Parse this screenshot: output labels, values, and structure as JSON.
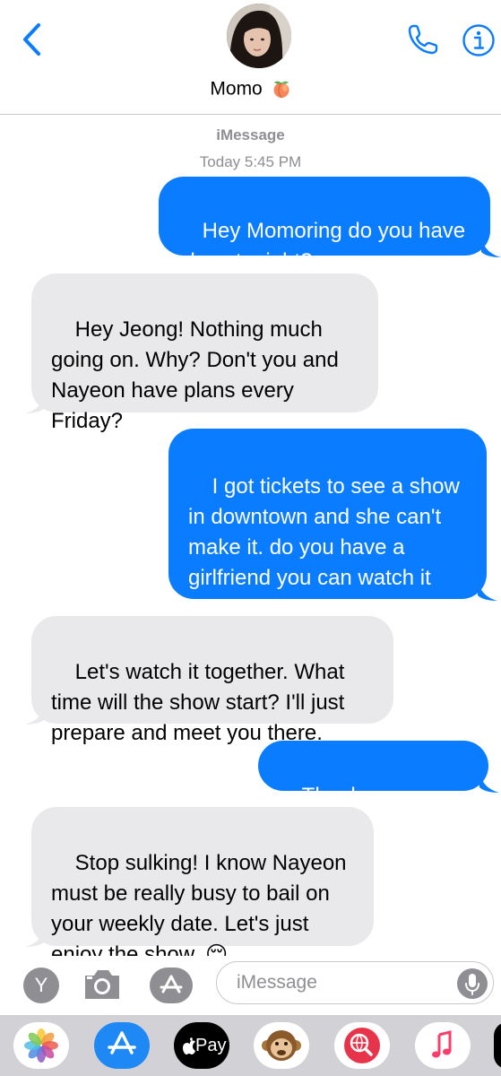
{
  "header": {
    "contact_name": "Momo",
    "contact_emoji": "peach",
    "back_icon": "chevron-left-icon",
    "call_icon": "phone-icon",
    "info_icon": "info-icon",
    "accent_color": "#0a7cff"
  },
  "thread": {
    "service": "iMessage",
    "timestamp": "Today 5:45 PM",
    "messages": [
      {
        "from": "me",
        "text": "Hey Momoring do you have plans tonight?"
      },
      {
        "from": "them",
        "text": "Hey Jeong! Nothing much going on. Why? Don't you and Nayeon have plans every Friday?"
      },
      {
        "from": "me",
        "text": "I got tickets to see a show in downtown and she can't make it. do you have a girlfriend you can watch it with? I'll give it to you."
      },
      {
        "from": "them",
        "text": "Let's watch it together. What time will the show start? I'll just prepare and meet you there."
      },
      {
        "from": "me",
        "text": "Thank you Momo."
      },
      {
        "from": "them",
        "text": "Stop sulking! I know Nayeon must be really busy to bail on your weekly date. Let's just enjoy the show. 😌"
      }
    ],
    "sent_color": "#0a7cff",
    "received_color": "#e9e9eb"
  },
  "input_bar": {
    "y_button_label": "Y",
    "camera_icon": "camera-icon",
    "apps_icon": "app-store-icon",
    "placeholder": "iMessage",
    "mic_icon": "microphone-icon"
  },
  "app_drawer": {
    "apps": [
      {
        "name": "photos",
        "icon": "photos-icon"
      },
      {
        "name": "app-store",
        "icon": "app-store-icon"
      },
      {
        "name": "apple-pay",
        "icon": "apple-pay-icon",
        "label": "Pay"
      },
      {
        "name": "animoji",
        "icon": "monkey-icon"
      },
      {
        "name": "web-search",
        "icon": "globe-search-icon"
      },
      {
        "name": "music",
        "icon": "music-icon"
      }
    ]
  }
}
